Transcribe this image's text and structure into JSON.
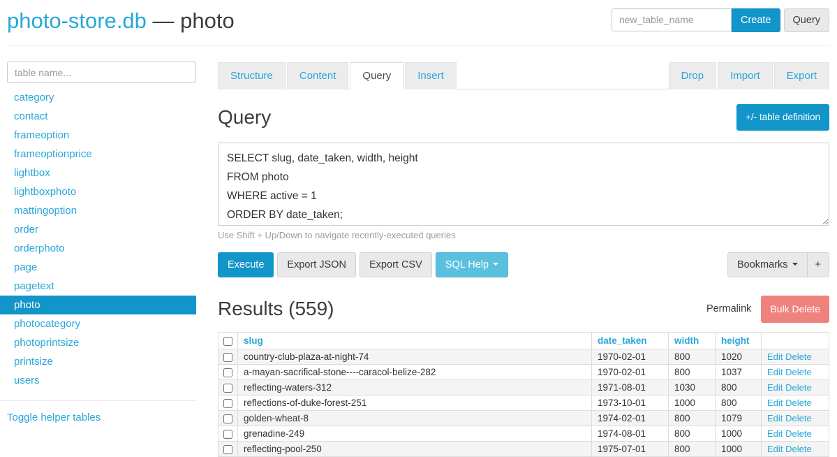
{
  "header": {
    "db_name": "photo-store.db",
    "dash": "—",
    "table_name": "photo",
    "new_table_placeholder": "new_table_name",
    "create_button": "Create",
    "query_button": "Query"
  },
  "sidebar": {
    "filter_placeholder": "table name...",
    "tables": [
      "category",
      "contact",
      "frameoption",
      "frameoptionprice",
      "lightbox",
      "lightboxphoto",
      "mattingoption",
      "order",
      "orderphoto",
      "page",
      "pagetext",
      "photo",
      "photocategory",
      "photoprintsize",
      "printsize",
      "users"
    ],
    "selected_table": "photo",
    "toggle_helper_label": "Toggle helper tables"
  },
  "tabs": {
    "left": [
      "Structure",
      "Content",
      "Query",
      "Insert"
    ],
    "active": "Query",
    "right": [
      "Drop",
      "Import",
      "Export"
    ]
  },
  "query": {
    "heading": "Query",
    "table_definition_button": "+/- table definition",
    "sql": "SELECT slug, date_taken, width, height\nFROM photo\nWHERE active = 1\nORDER BY date_taken;",
    "hint": "Use Shift + Up/Down to navigate recently-executed queries",
    "execute_button": "Execute",
    "export_json_button": "Export JSON",
    "export_csv_button": "Export CSV",
    "sql_help_button": "SQL Help",
    "bookmarks_button": "Bookmarks",
    "add_bookmark_button": "+"
  },
  "results": {
    "heading": "Results (559)",
    "permalink_label": "Permalink",
    "bulk_delete_button": "Bulk Delete",
    "columns": [
      "slug",
      "date_taken",
      "width",
      "height"
    ],
    "edit_label": "Edit",
    "delete_label": "Delete",
    "rows": [
      {
        "slug": "country-club-plaza-at-night-74",
        "date_taken": "1970-02-01",
        "width": "800",
        "height": "1020"
      },
      {
        "slug": "a-mayan-sacrifical-stone----caracol-belize-282",
        "date_taken": "1970-02-01",
        "width": "800",
        "height": "1037"
      },
      {
        "slug": "reflecting-waters-312",
        "date_taken": "1971-08-01",
        "width": "1030",
        "height": "800"
      },
      {
        "slug": "reflections-of-duke-forest-251",
        "date_taken": "1973-10-01",
        "width": "1000",
        "height": "800"
      },
      {
        "slug": "golden-wheat-8",
        "date_taken": "1974-02-01",
        "width": "800",
        "height": "1079"
      },
      {
        "slug": "grenadine-249",
        "date_taken": "1974-08-01",
        "width": "800",
        "height": "1000"
      },
      {
        "slug": "reflecting-pool-250",
        "date_taken": "1975-07-01",
        "width": "800",
        "height": "1000"
      }
    ]
  },
  "colors": {
    "accent": "#1295c9",
    "link": "#28a7d9",
    "info": "#5bc0de",
    "danger": "#f0827e"
  }
}
